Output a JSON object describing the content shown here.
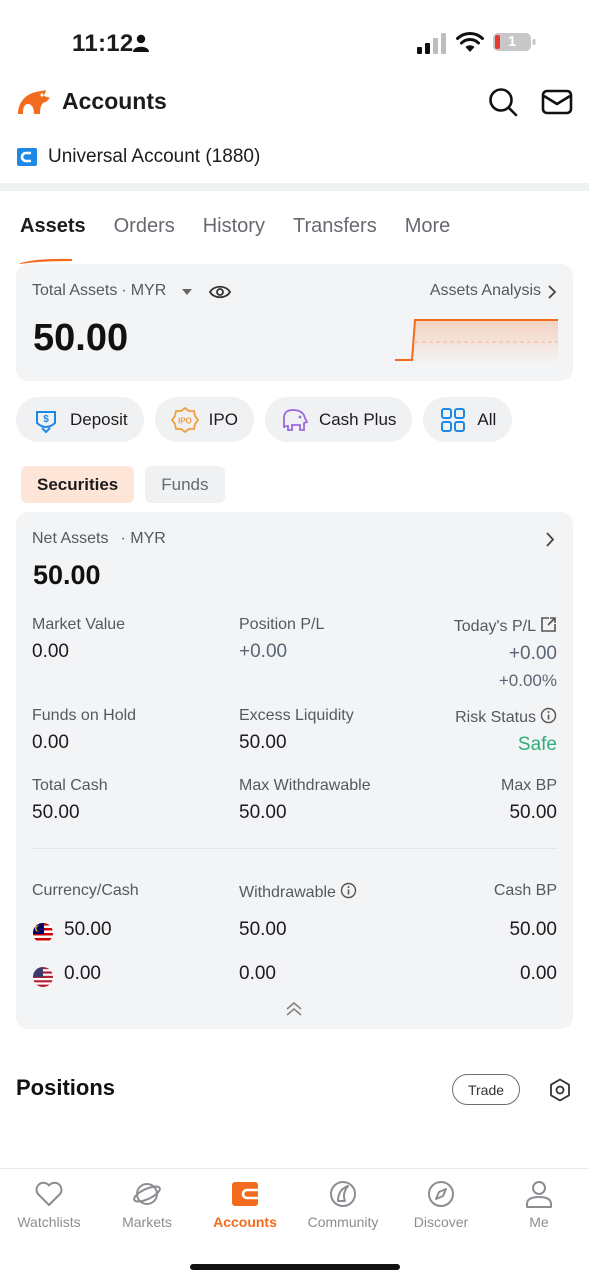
{
  "status_bar": {
    "time": "11:12",
    "battery": "1"
  },
  "header": {
    "title": "Accounts"
  },
  "account": {
    "name": "Universal Account (1880)"
  },
  "tabs": [
    {
      "label": "Assets",
      "active": true
    },
    {
      "label": "Orders"
    },
    {
      "label": "History"
    },
    {
      "label": "Transfers"
    },
    {
      "label": "More"
    }
  ],
  "total_assets": {
    "label": "Total Assets",
    "currency": "MYR",
    "analysis_label": "Assets Analysis",
    "value": "50.00"
  },
  "quick_actions": [
    {
      "label": "Deposit",
      "icon": "deposit-icon"
    },
    {
      "label": "IPO",
      "icon": "ipo-icon"
    },
    {
      "label": "Cash Plus",
      "icon": "cash-plus-icon"
    },
    {
      "label": "All",
      "icon": "grid-icon"
    }
  ],
  "sub_tabs": [
    {
      "label": "Securities",
      "active": true
    },
    {
      "label": "Funds"
    }
  ],
  "net_assets": {
    "label": "Net Assets",
    "currency": "MYR",
    "value": "50.00",
    "market_value": {
      "label": "Market Value",
      "value": "0.00"
    },
    "position_pl": {
      "label": "Position P/L",
      "value": "+0.00"
    },
    "todays_pl": {
      "label": "Today's P/L",
      "value": "+0.00",
      "percent": "+0.00%"
    },
    "funds_on_hold": {
      "label": "Funds on Hold",
      "value": "0.00"
    },
    "excess_liquidity": {
      "label": "Excess Liquidity",
      "value": "50.00"
    },
    "risk_status": {
      "label": "Risk Status",
      "value": "Safe"
    },
    "total_cash": {
      "label": "Total Cash",
      "value": "50.00"
    },
    "max_withdrawable": {
      "label": "Max Withdrawable",
      "value": "50.00"
    },
    "max_bp": {
      "label": "Max BP",
      "value": "50.00"
    }
  },
  "currency_table": {
    "headers": [
      "Currency/Cash",
      "Withdrawable",
      "Cash BP"
    ],
    "rows": [
      {
        "flag": "malaysia-flag",
        "cash": "50.00",
        "withdrawable": "50.00",
        "cash_bp": "50.00"
      },
      {
        "flag": "us-flag",
        "cash": "0.00",
        "withdrawable": "0.00",
        "cash_bp": "0.00"
      }
    ]
  },
  "positions": {
    "title": "Positions",
    "trade_label": "Trade"
  },
  "bottom_nav": [
    {
      "label": "Watchlists",
      "icon": "heart-icon"
    },
    {
      "label": "Markets",
      "icon": "planet-icon"
    },
    {
      "label": "Accounts",
      "icon": "wallet-icon",
      "active": true
    },
    {
      "label": "Community",
      "icon": "community-icon"
    },
    {
      "label": "Discover",
      "icon": "compass-icon"
    },
    {
      "label": "Me",
      "icon": "person-icon"
    }
  ],
  "colors": {
    "accent": "#f36b1c",
    "safe": "#2fae77",
    "card_bg": "#f3f4f6"
  }
}
